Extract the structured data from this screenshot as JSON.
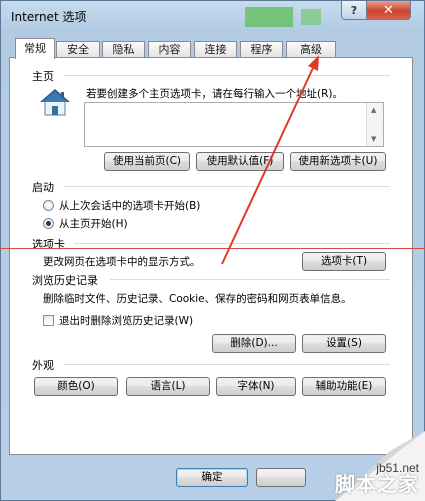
{
  "window": {
    "title": "Internet 选项"
  },
  "tabs": [
    {
      "label": "常规",
      "active": true
    },
    {
      "label": "安全"
    },
    {
      "label": "隐私"
    },
    {
      "label": "内容"
    },
    {
      "label": "连接"
    },
    {
      "label": "程序"
    },
    {
      "label": "高级"
    }
  ],
  "home": {
    "group": "主页",
    "desc": "若要创建多个主页选项卡，请在每行输入一个地址(R)。",
    "url_value": "",
    "btn_current": "使用当前页(C)",
    "btn_default": "使用默认值(F)",
    "btn_newtab": "使用新选项卡(U)"
  },
  "startup": {
    "group": "启动",
    "opt1": "从上次会话中的选项卡开始(B)",
    "opt2": "从主页开始(H)",
    "selected": "opt2"
  },
  "tabs_group": {
    "group": "选项卡",
    "desc": "更改网页在选项卡中的显示方式。",
    "btn": "选项卡(T)"
  },
  "history": {
    "group": "浏览历史记录",
    "desc": "删除临时文件、历史记录、Cookie、保存的密码和网页表单信息。",
    "checkbox": "退出时删除浏览历史记录(W)",
    "checked": false,
    "btn_delete": "删除(D)...",
    "btn_settings": "设置(S)"
  },
  "appearance": {
    "group": "外观",
    "btn_colors": "颜色(O)",
    "btn_languages": "语言(L)",
    "btn_fonts": "字体(N)",
    "btn_access": "辅助功能(E)"
  },
  "footer": {
    "ok": "确定"
  },
  "watermark": {
    "site": "jb51.net",
    "brand": "脚本之家"
  },
  "colors": {
    "annotation": "#e0392b",
    "selection": "#1d3d63"
  }
}
